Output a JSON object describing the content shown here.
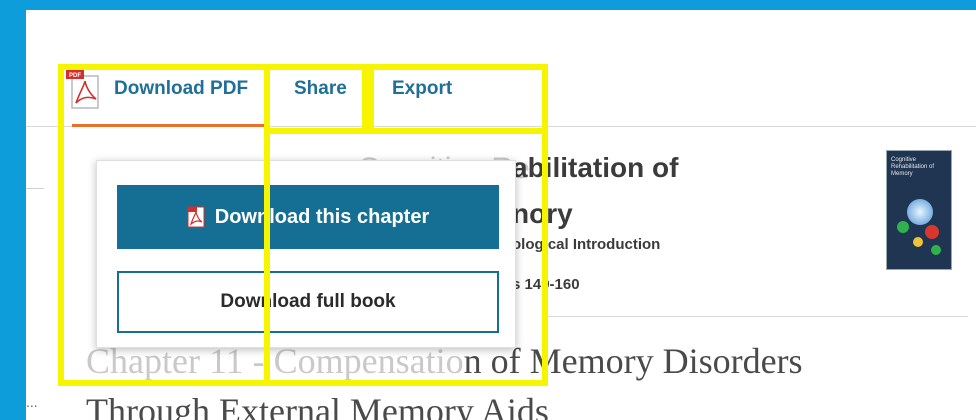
{
  "tabs": {
    "download_pdf": "Download PDF",
    "share": "Share",
    "export": "Export"
  },
  "article": {
    "title_line1": "abilitation of",
    "title_line2": "nory",
    "subtitle": "ological Introduction",
    "pages": "s 149-160",
    "faded_title_fragment": "Cognitive Re"
  },
  "book_cover": {
    "title": "Cognitive Rehabilitation of Memory"
  },
  "chapter": {
    "line1_faded": "Chapter 11 - Compensatio",
    "line1": "n of Memory Disorders",
    "line2": "Through External Memory Aids"
  },
  "dropdown": {
    "download_chapter": "Download this chapter",
    "download_full_book": "Download full book"
  },
  "misc": {
    "ellipsis": "..."
  },
  "colors": {
    "accent": "#156f94",
    "highlight": "#f7f400",
    "tab_underline": "#e8702a",
    "frame": "#0e9ddb"
  }
}
